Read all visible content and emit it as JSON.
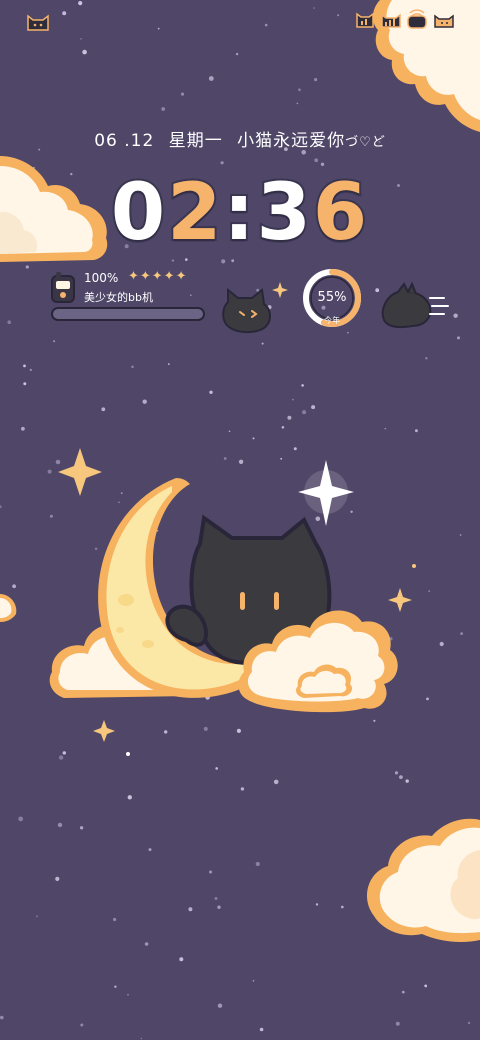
{
  "status_bar": {
    "left_icon": "cat-face-icon",
    "right_icons": [
      "cat-signal-icon",
      "cat-cellular-icon",
      "cat-wifi-icon",
      "cat-battery-icon"
    ]
  },
  "date_line": {
    "date": "06 .12",
    "weekday": "星期一",
    "slogan": "小猫永远爱你",
    "kaomoji": "づ♡ど"
  },
  "clock": {
    "hour_1": "0",
    "hour_2": "2",
    "separator": ":",
    "minute_1": "3",
    "minute_2": "6"
  },
  "battery_widget": {
    "percent": "100%",
    "stars": "✦✦✦✦✦",
    "device_name": "美少女的bb机",
    "level": 1.0,
    "icon": "pager-icon"
  },
  "ring_widget": {
    "value": "55%",
    "label": "今年",
    "progress": 0.55
  },
  "colors": {
    "background": "#4f4668",
    "accent_orange": "#f6b36c",
    "moon_yellow": "#fbe8a6",
    "cloud_cream": "#fff6e8",
    "cat_black": "#3b3b3f"
  },
  "illustration": {
    "icons": [
      "crescent-moon-icon",
      "black-cat-icon",
      "cloud-icon",
      "star-icon"
    ]
  }
}
